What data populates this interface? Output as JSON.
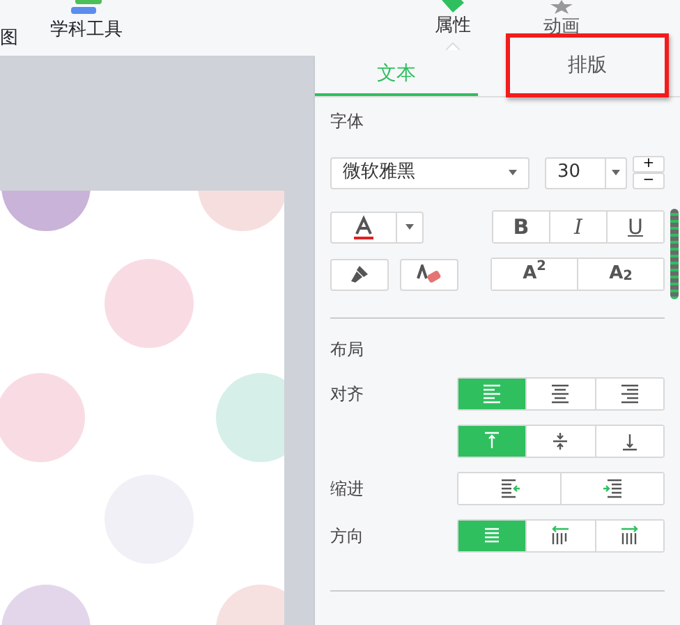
{
  "toolbar": {
    "items": [
      {
        "label": "图"
      },
      {
        "label": "学科工具"
      }
    ],
    "side_tabs": [
      {
        "label": "属性",
        "selected": true
      },
      {
        "label": "动画",
        "selected": false
      }
    ]
  },
  "panel": {
    "tabs": [
      {
        "label": "文本",
        "selected": true,
        "highlighted": false
      },
      {
        "label": "排版",
        "selected": false,
        "highlighted": true
      }
    ],
    "font": {
      "title": "字体",
      "family": "微软雅黑",
      "size": "30",
      "size_up": "+",
      "size_down": "−",
      "styles": [
        {
          "label": "B",
          "kind": "bold"
        },
        {
          "label": "I",
          "kind": "italic"
        },
        {
          "label": "U",
          "kind": "underline"
        }
      ],
      "scripts": [
        {
          "label": "A$^{2}$"
        },
        {
          "label": "A$_{2}$"
        }
      ]
    },
    "layout": {
      "title": "布局",
      "rows": [
        {
          "label": "对齐",
          "options": [
            {
              "kind": "left",
              "selected": true
            },
            {
              "kind": "center",
              "selected": false
            },
            {
              "kind": "right",
              "selected": false
            }
          ]
        },
        {
          "options": [
            {
              "kind": "top",
              "selected": true
            },
            {
              "kind": "middle",
              "selected": false
            },
            {
              "kind": "bottom",
              "selected": false
            }
          ]
        },
        {
          "label": "缩进",
          "options": [
            {
              "kind": "outdent",
              "selected": false
            },
            {
              "kind": "indent",
              "selected": false
            }
          ]
        },
        {
          "label": "方向",
          "options": [
            {
              "kind": "horizontal",
              "selected": true
            },
            {
              "kind": "vertical-rtl",
              "selected": false
            },
            {
              "kind": "vertical-ltr",
              "selected": false
            }
          ]
        }
      ]
    }
  }
}
